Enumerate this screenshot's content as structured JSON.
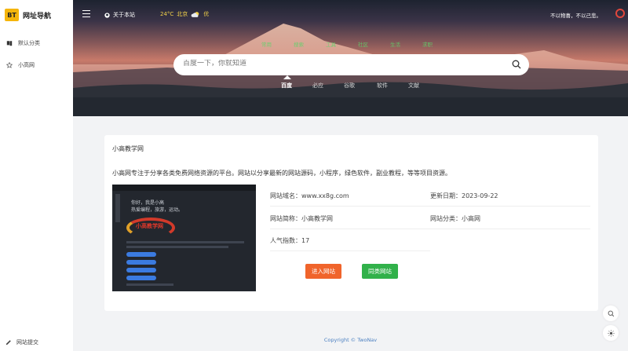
{
  "brand": {
    "badge": "BT",
    "name": "网址导航"
  },
  "sidebar": {
    "items": [
      {
        "label": "默认分类",
        "icon": "book-icon"
      },
      {
        "label": "小高网",
        "icon": "star-icon"
      }
    ],
    "submit_label": "网站提交"
  },
  "topbar": {
    "about_label": "关于本站",
    "weather": {
      "temp": "24°C",
      "city": "北京",
      "quality": "优"
    },
    "slogan": "不以物喜，不以己悲。"
  },
  "categories": [
    "常用",
    "搜索",
    "工具",
    "社区",
    "生活",
    "求职"
  ],
  "search": {
    "placeholder": "百度一下，你就知道",
    "engines": [
      "百度",
      "必应",
      "谷歌",
      "软件",
      "文献"
    ],
    "active_engine": "百度"
  },
  "site": {
    "title": "小高教学网",
    "description": "小高网专注于分享各类免费网络资源的平台。网站以分享最新的网站源码，小程序，绿色软件，副业教程，等等项目资源。",
    "domain_label": "网站域名：",
    "domain": "www.xx8g.com",
    "updated_label": "更新日期：",
    "updated": "2023-09-22",
    "short_label": "网站简称：",
    "short": "小高教学网",
    "category_label": "网站分类：",
    "category": "小高网",
    "popularity_label": "人气指数：",
    "popularity": "17",
    "enter_label": "进入网站",
    "same_label": "同类网站"
  },
  "thumbnail": {
    "greeting1": "你好，我是小高",
    "greeting2": "热爱编程，旅游，运动。",
    "logo_text": "小高教学网"
  },
  "footer": {
    "copyright": "Copyright © TwoNav"
  },
  "colors": {
    "accent_orange": "#f0642b",
    "accent_green": "#31b14a",
    "weather_yellow": "#f3d24a",
    "logo_yellow": "#f5b50a"
  }
}
